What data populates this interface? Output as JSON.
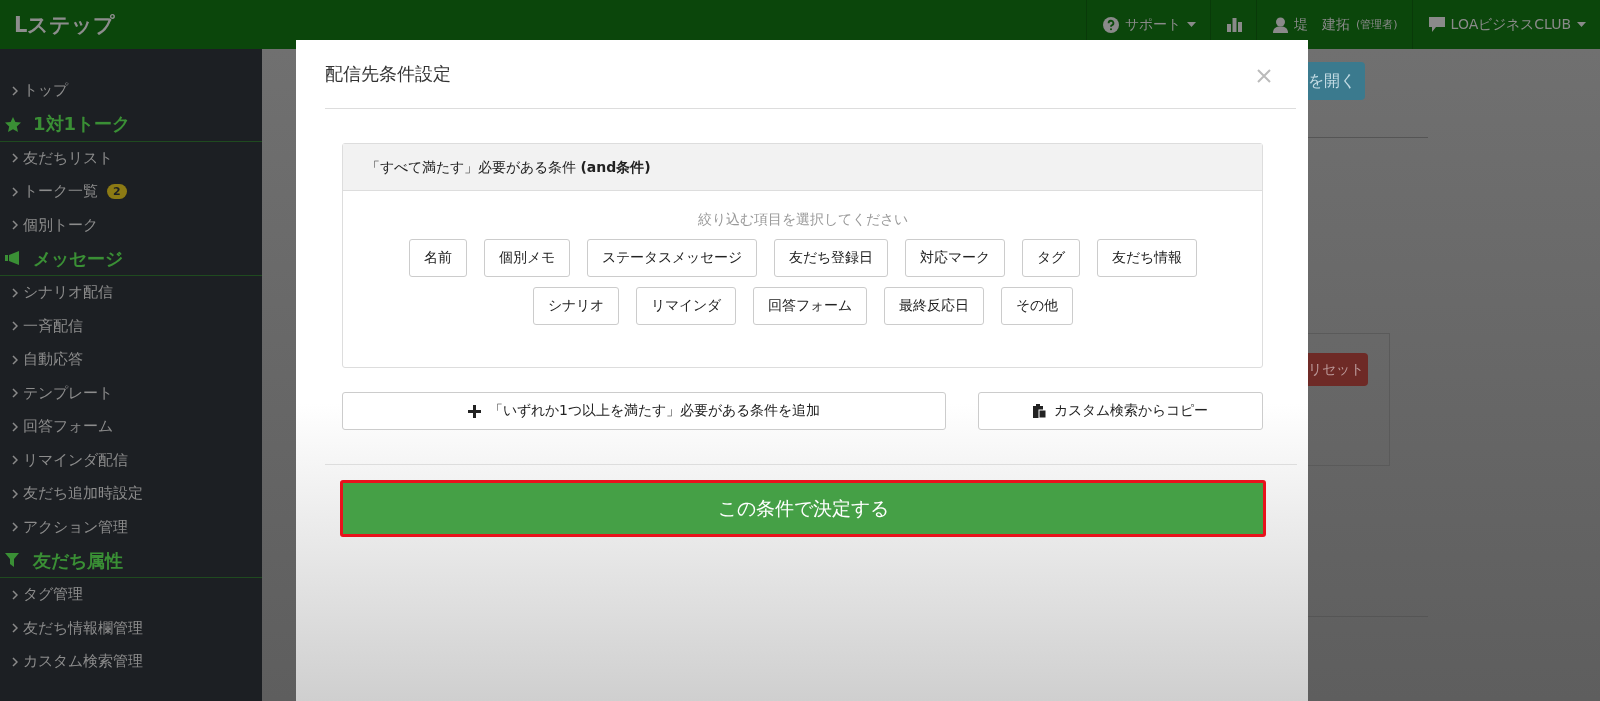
{
  "navbar": {
    "logo": "Lステップ",
    "support": "サポート",
    "user_name": "堤　建拓",
    "user_role": "(管理者)",
    "account": "LOAビジネスCLUB"
  },
  "sidebar": [
    {
      "items": [
        {
          "label": "トップ"
        }
      ]
    },
    {
      "heading": "1対1トーク",
      "items": [
        {
          "label": "友だちリスト"
        },
        {
          "label": "トーク一覧",
          "badge": "2"
        },
        {
          "label": "個別トーク"
        }
      ]
    },
    {
      "heading": "メッセージ",
      "items": [
        {
          "label": "シナリオ配信"
        },
        {
          "label": "一斉配信"
        },
        {
          "label": "自動応答"
        },
        {
          "label": "テンプレート"
        },
        {
          "label": "回答フォーム"
        },
        {
          "label": "リマインダ配信"
        },
        {
          "label": "友だち追加時設定"
        },
        {
          "label": "アクション管理"
        }
      ]
    },
    {
      "heading": "友だち属性",
      "items": [
        {
          "label": "タグ管理"
        },
        {
          "label": "友だち情報欄管理"
        },
        {
          "label": "カスタム検索管理"
        }
      ]
    }
  ],
  "background": {
    "open_button": "を開く",
    "reset_button": "リセット"
  },
  "modal": {
    "title": "配信先条件設定",
    "panel_title": "「すべて満たす」必要がある条件 **(and条件)**",
    "hint": "絞り込む項目を選択してください",
    "filter_rows": [
      [
        "名前",
        "個別メモ",
        "ステータスメッセージ",
        "友だち登録日",
        "対応マーク",
        "タグ",
        "友だち情報"
      ],
      [
        "シナリオ",
        "リマインダ",
        "回答フォーム",
        "最終反応日",
        "その他"
      ]
    ],
    "add_or_button": "「いずれか1つ以上を満たす」必要がある条件を追加",
    "copy_button": "カスタム検索からコピー",
    "submit_button": "この条件で決定する"
  }
}
